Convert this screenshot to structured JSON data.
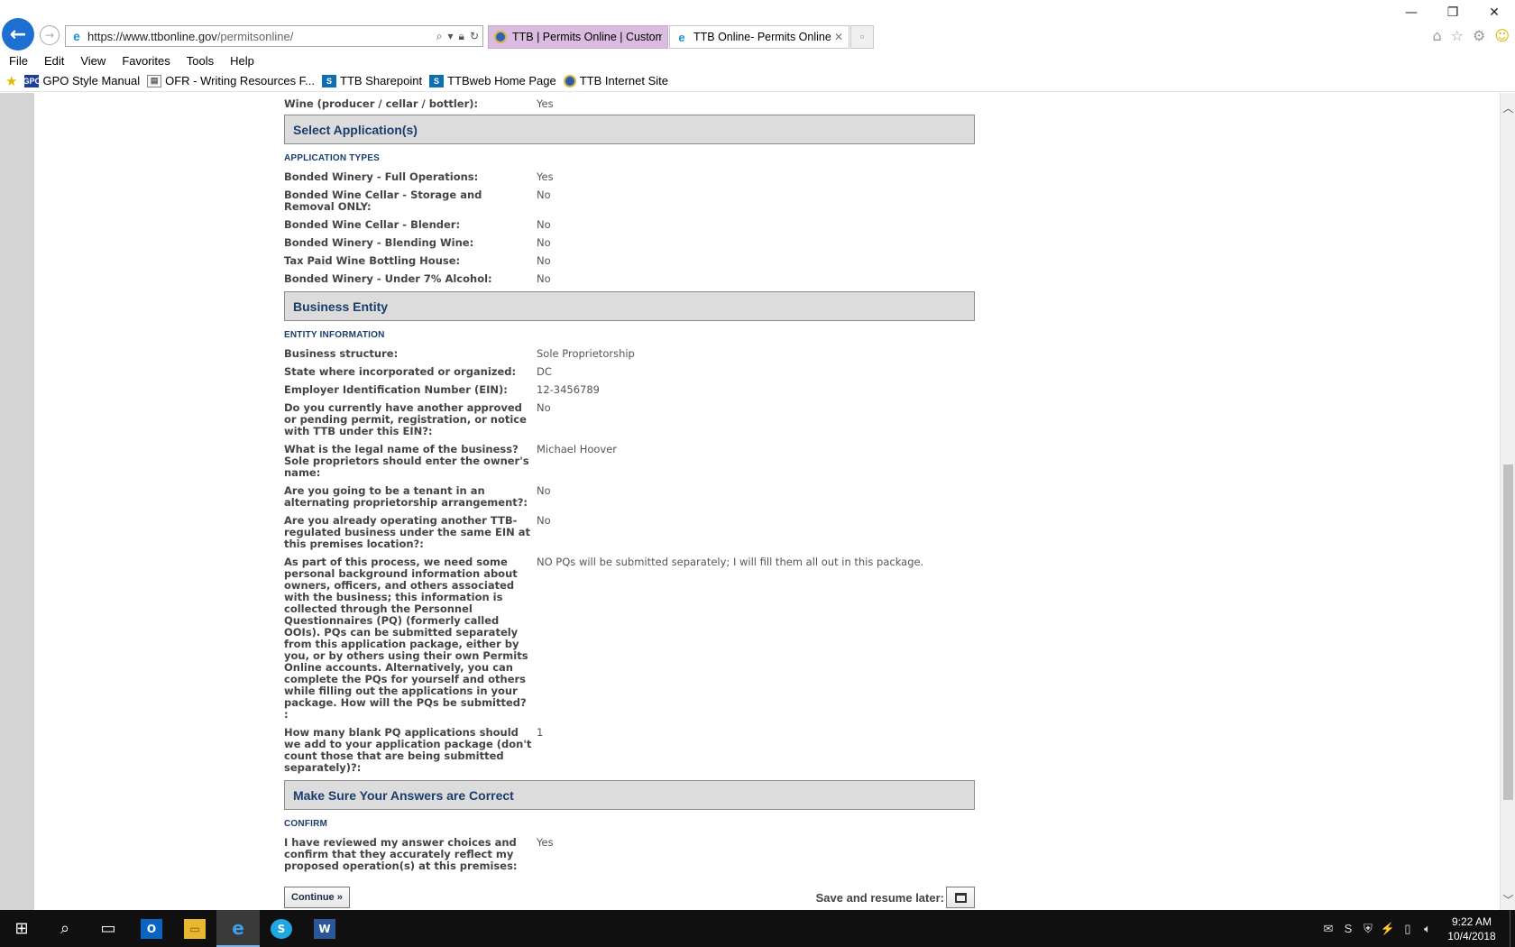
{
  "browser": {
    "address_host": "https://www.ttbonline.gov",
    "address_path": "/permitsonline/",
    "tabs": [
      {
        "title": "TTB | Permits Online | Custom..."
      },
      {
        "title": "TTB Online- Permits Online..."
      }
    ],
    "menu": [
      "File",
      "Edit",
      "View",
      "Favorites",
      "Tools",
      "Help"
    ],
    "favorites": [
      {
        "label": "GPO Style Manual",
        "icon": "GPO"
      },
      {
        "label": "OFR - Writing Resources F...",
        "icon": "page"
      },
      {
        "label": "TTB Sharepoint",
        "icon": "S"
      },
      {
        "label": "TTBweb Home Page",
        "icon": "S"
      },
      {
        "label": "TTB Internet Site",
        "icon": "seal"
      }
    ]
  },
  "page": {
    "top_row": {
      "label": "Wine (producer / cellar / bottler):",
      "value": "Yes"
    },
    "sections": [
      {
        "title": "Select Application(s)",
        "subhead": "APPLICATION TYPES",
        "rows": [
          {
            "label": "Bonded Winery - Full Operations:",
            "value": "Yes"
          },
          {
            "label": "Bonded Wine Cellar - Storage and Removal ONLY:",
            "value": "No"
          },
          {
            "label": "Bonded Wine Cellar - Blender:",
            "value": "No"
          },
          {
            "label": "Bonded Winery - Blending Wine:",
            "value": "No"
          },
          {
            "label": "Tax Paid Wine Bottling House:",
            "value": "No"
          },
          {
            "label": "Bonded Winery - Under 7% Alcohol:",
            "value": "No"
          }
        ]
      },
      {
        "title": "Business Entity",
        "subhead": "ENTITY INFORMATION",
        "rows": [
          {
            "label": "Business structure:",
            "value": "Sole Proprietorship"
          },
          {
            "label": "State where incorporated or organized:",
            "value": "DC"
          },
          {
            "label": "Employer Identification Number (EIN):",
            "value": "12-3456789"
          },
          {
            "label": "Do you currently have another approved or pending permit, registration, or notice with TTB under this EIN?:",
            "value": "No"
          },
          {
            "label": "What is the legal name of the business? Sole proprietors should enter the owner's name:",
            "value": "Michael Hoover"
          },
          {
            "label": "Are you going to be a tenant in an alternating proprietorship arrangement?:",
            "value": "No"
          },
          {
            "label": "Are you already operating another TTB-regulated business under the same EIN at this premises location?:",
            "value": "No"
          },
          {
            "label": "As part of this process, we need some personal background information about owners, officers, and others associated with the business; this information is collected through the Personnel Questionnaires (PQ) (formerly called OOIs). PQs can be submitted separately from this application package, either by you, or by others using their own Permits Online accounts. Alternatively, you can complete the PQs for yourself and others while filling out the applications in your package. How will the PQs be submitted? :",
            "value": "NO PQs will be submitted separately; I will fill them all out in this package."
          },
          {
            "label": "How many blank PQ applications should we add to your application package (don't count those that are being submitted separately)?:",
            "value": "1"
          }
        ]
      },
      {
        "title": "Make Sure Your Answers are Correct",
        "subhead": "CONFIRM",
        "rows": [
          {
            "label": "I have reviewed my answer choices and confirm that they accurately reflect my proposed operation(s) at this premises:",
            "value": "Yes"
          }
        ]
      }
    ],
    "continue_label": "Continue »",
    "save_later_label": "Save and resume later:"
  },
  "taskbar": {
    "time": "9:22 AM",
    "date": "10/4/2018"
  },
  "colors": {
    "section_title": "#1a3d6e",
    "section_bg": "#dcdcdc",
    "ie_blue": "#1e6fd1",
    "active_tab": "#d9bce0"
  }
}
